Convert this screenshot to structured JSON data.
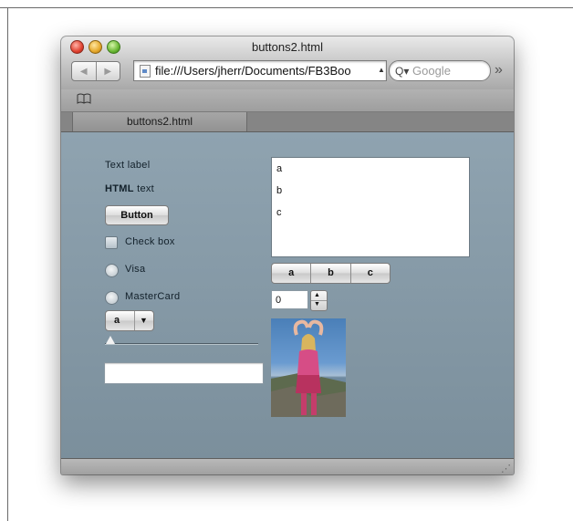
{
  "window": {
    "title": "buttons2.html",
    "url": "file:///Users/jherr/Documents/FB3Boo",
    "search_placeholder": "Google",
    "tab_label": "buttons2.html"
  },
  "content": {
    "text_label": "Text label",
    "html_text_bold": "HTML",
    "html_text_rest": " text",
    "button_label": "Button",
    "checkbox_label": "Check box",
    "radio_visa_label": "Visa",
    "radio_mastercard_label": "MasterCard",
    "popup_value": "a",
    "list_items": [
      "a",
      "b",
      "c"
    ],
    "segments": [
      "a",
      "b",
      "c"
    ],
    "stepper_value": "0",
    "text_input_value": ""
  },
  "icons": {
    "back": "back-arrow-icon",
    "forward": "forward-arrow-icon",
    "page": "page-icon",
    "search": "search-icon",
    "overflow": "chevron-double-right-icon",
    "bookmarks": "book-icon",
    "resize": "resize-grip-icon"
  }
}
